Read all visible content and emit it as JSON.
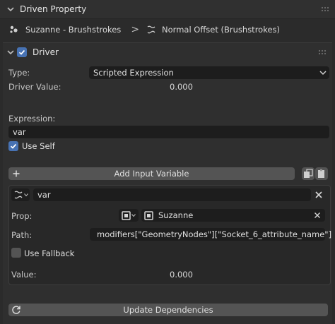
{
  "panel": {
    "title": "Driven Property"
  },
  "breadcrumb": {
    "object": "Suzanne - Brushstrokes",
    "separator": ">",
    "property": "Normal Offset (Brushstrokes)"
  },
  "driver": {
    "header": "Driver",
    "type_label": "Type:",
    "type_value": "Scripted Expression",
    "driver_value_label": "Driver Value:",
    "driver_value": "0.000",
    "expression_label": "Expression:",
    "expression_value": "var",
    "use_self_label": "Use Self",
    "add_variable_label": "Add Input Variable"
  },
  "variable": {
    "name": "var",
    "prop_label": "Prop:",
    "prop_target": "Suzanne",
    "path_label": "Path:",
    "path_value": "modifiers[\"GeometryNodes\"][\"Socket_6_attribute_name\"]",
    "use_fallback_label": "Use Fallback",
    "value_label": "Value:",
    "value": "0.000"
  },
  "footer": {
    "update_label": "Update Dependencies"
  },
  "colors": {
    "accent": "#4772b3",
    "field": "#1d1d1d",
    "button": "#545454"
  }
}
